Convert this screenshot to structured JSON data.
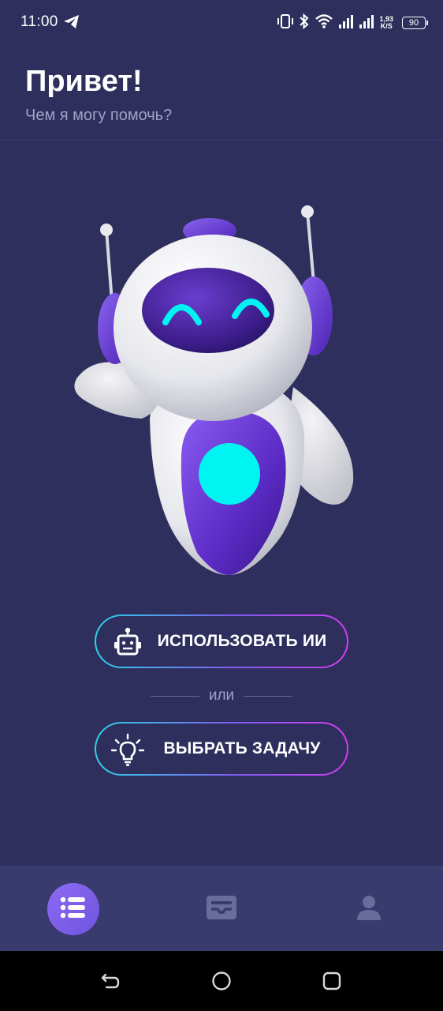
{
  "status_bar": {
    "time": "11:00",
    "net_speed_value": "1,93",
    "net_speed_unit": "K/S",
    "battery": "90",
    "icons": [
      "telegram-icon",
      "vibrate-icon",
      "bluetooth-icon",
      "wifi-icon",
      "signal-icon",
      "signal-icon"
    ]
  },
  "header": {
    "greeting": "Привет!",
    "subtitle": "Чем я могу помочь?"
  },
  "actions": {
    "use_ai_label": "ИСПОЛЬЗОВАТЬ ИИ",
    "or_label": "или",
    "choose_task_label": "ВЫБРАТЬ ЗАДАЧУ"
  },
  "bottom_nav": {
    "items": [
      {
        "icon": "list-icon",
        "active": true
      },
      {
        "icon": "card-icon",
        "active": false
      },
      {
        "icon": "profile-icon",
        "active": false
      }
    ]
  },
  "system_nav": {
    "buttons": [
      "back-icon",
      "home-icon",
      "recents-icon"
    ]
  },
  "colors": {
    "background": "#2e2f5d",
    "nav_background": "#393a6e",
    "accent_cyan": "#2dd3e8",
    "accent_purple": "#7e5cf0",
    "accent_magenta": "#d43df0"
  }
}
